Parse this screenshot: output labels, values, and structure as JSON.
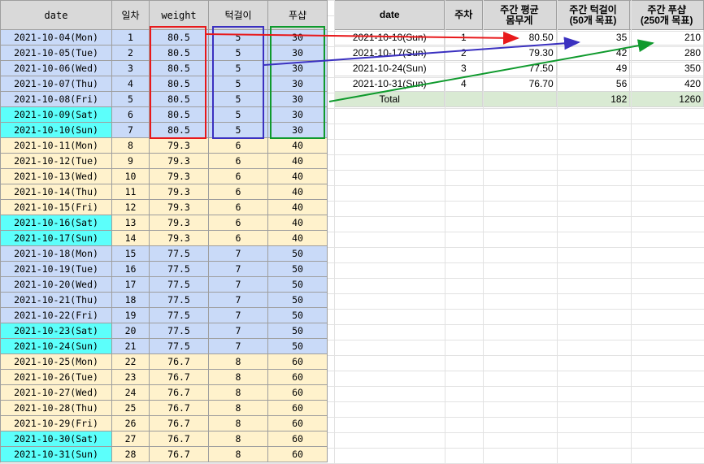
{
  "left_table": {
    "headers": {
      "date": "date",
      "day": "일차",
      "weight": "weight",
      "pullup": "턱걸이",
      "pushup": "푸샵"
    },
    "rows": [
      {
        "date": "2021-10-04(Mon)",
        "day": "1",
        "weight": "80.5",
        "pullup": "5",
        "pushup": "30"
      },
      {
        "date": "2021-10-05(Tue)",
        "day": "2",
        "weight": "80.5",
        "pullup": "5",
        "pushup": "30"
      },
      {
        "date": "2021-10-06(Wed)",
        "day": "3",
        "weight": "80.5",
        "pullup": "5",
        "pushup": "30"
      },
      {
        "date": "2021-10-07(Thu)",
        "day": "4",
        "weight": "80.5",
        "pullup": "5",
        "pushup": "30"
      },
      {
        "date": "2021-10-08(Fri)",
        "day": "5",
        "weight": "80.5",
        "pullup": "5",
        "pushup": "30"
      },
      {
        "date": "2021-10-09(Sat)",
        "day": "6",
        "weight": "80.5",
        "pullup": "5",
        "pushup": "30"
      },
      {
        "date": "2021-10-10(Sun)",
        "day": "7",
        "weight": "80.5",
        "pullup": "5",
        "pushup": "30"
      },
      {
        "date": "2021-10-11(Mon)",
        "day": "8",
        "weight": "79.3",
        "pullup": "6",
        "pushup": "40"
      },
      {
        "date": "2021-10-12(Tue)",
        "day": "9",
        "weight": "79.3",
        "pullup": "6",
        "pushup": "40"
      },
      {
        "date": "2021-10-13(Wed)",
        "day": "10",
        "weight": "79.3",
        "pullup": "6",
        "pushup": "40"
      },
      {
        "date": "2021-10-14(Thu)",
        "day": "11",
        "weight": "79.3",
        "pullup": "6",
        "pushup": "40"
      },
      {
        "date": "2021-10-15(Fri)",
        "day": "12",
        "weight": "79.3",
        "pullup": "6",
        "pushup": "40"
      },
      {
        "date": "2021-10-16(Sat)",
        "day": "13",
        "weight": "79.3",
        "pullup": "6",
        "pushup": "40"
      },
      {
        "date": "2021-10-17(Sun)",
        "day": "14",
        "weight": "79.3",
        "pullup": "6",
        "pushup": "40"
      },
      {
        "date": "2021-10-18(Mon)",
        "day": "15",
        "weight": "77.5",
        "pullup": "7",
        "pushup": "50"
      },
      {
        "date": "2021-10-19(Tue)",
        "day": "16",
        "weight": "77.5",
        "pullup": "7",
        "pushup": "50"
      },
      {
        "date": "2021-10-20(Wed)",
        "day": "17",
        "weight": "77.5",
        "pullup": "7",
        "pushup": "50"
      },
      {
        "date": "2021-10-21(Thu)",
        "day": "18",
        "weight": "77.5",
        "pullup": "7",
        "pushup": "50"
      },
      {
        "date": "2021-10-22(Fri)",
        "day": "19",
        "weight": "77.5",
        "pullup": "7",
        "pushup": "50"
      },
      {
        "date": "2021-10-23(Sat)",
        "day": "20",
        "weight": "77.5",
        "pullup": "7",
        "pushup": "50"
      },
      {
        "date": "2021-10-24(Sun)",
        "day": "21",
        "weight": "77.5",
        "pullup": "7",
        "pushup": "50"
      },
      {
        "date": "2021-10-25(Mon)",
        "day": "22",
        "weight": "76.7",
        "pullup": "8",
        "pushup": "60"
      },
      {
        "date": "2021-10-26(Tue)",
        "day": "23",
        "weight": "76.7",
        "pullup": "8",
        "pushup": "60"
      },
      {
        "date": "2021-10-27(Wed)",
        "day": "24",
        "weight": "76.7",
        "pullup": "8",
        "pushup": "60"
      },
      {
        "date": "2021-10-28(Thu)",
        "day": "25",
        "weight": "76.7",
        "pullup": "8",
        "pushup": "60"
      },
      {
        "date": "2021-10-29(Fri)",
        "day": "26",
        "weight": "76.7",
        "pullup": "8",
        "pushup": "60"
      },
      {
        "date": "2021-10-30(Sat)",
        "day": "27",
        "weight": "76.7",
        "pullup": "8",
        "pushup": "60"
      },
      {
        "date": "2021-10-31(Sun)",
        "day": "28",
        "weight": "76.7",
        "pullup": "8",
        "pushup": "60"
      }
    ]
  },
  "right_table": {
    "headers": {
      "date": "date",
      "week": "주차",
      "avg_weight_line1": "주간 평균",
      "avg_weight_line2": "몸무게",
      "pullup_line1": "주간 턱걸이",
      "pullup_line2": "(50개 목표)",
      "pushup_line1": "주간 푸샵",
      "pushup_line2": "(250개 목표)"
    },
    "rows": [
      {
        "date": "2021-10-10(Sun)",
        "week": "1",
        "avg_weight": "80.50",
        "pullup": "35",
        "pushup": "210"
      },
      {
        "date": "2021-10-17(Sun)",
        "week": "2",
        "avg_weight": "79.30",
        "pullup": "42",
        "pushup": "280"
      },
      {
        "date": "2021-10-24(Sun)",
        "week": "3",
        "avg_weight": "77.50",
        "pullup": "49",
        "pushup": "350"
      },
      {
        "date": "2021-10-31(Sun)",
        "week": "4",
        "avg_weight": "76.70",
        "pullup": "56",
        "pushup": "420"
      }
    ],
    "total": {
      "label": "Total",
      "pullup": "182",
      "pushup": "1260"
    }
  },
  "annotation_colors": {
    "weight": "#e8191b",
    "pullup": "#3b31c0",
    "pushup": "#0f9a2d"
  }
}
